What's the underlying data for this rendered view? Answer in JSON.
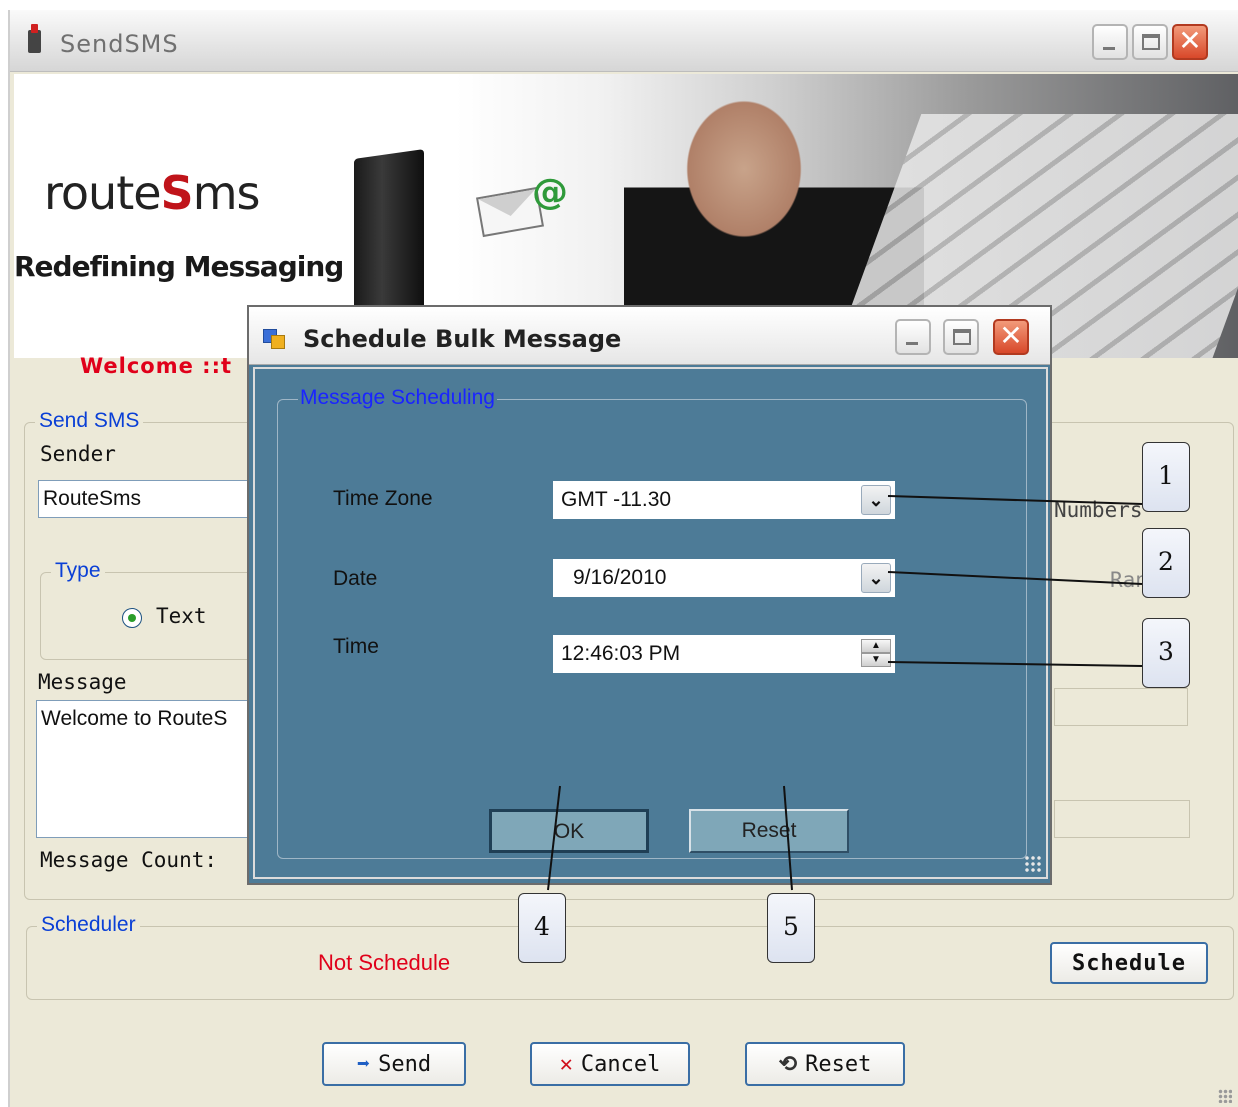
{
  "main_window": {
    "title": "SendSMS",
    "banner": {
      "logo_left": "route",
      "logo_s": "S",
      "logo_right": "ms",
      "tagline": "Redefining Messaging"
    },
    "welcome_text": "Welcome ::t",
    "send_sms": {
      "legend": "Send SMS",
      "sender_label": "Sender",
      "sender_value": "RouteSms",
      "type_legend": "Type",
      "type_option": "Text",
      "message_label": "Message",
      "message_value": "Welcome to RouteS",
      "message_count_label": "Message Count:",
      "right_partial_1": "Numbers",
      "right_partial_2": "Range"
    },
    "scheduler": {
      "legend": "Scheduler",
      "status": "Not Schedule",
      "schedule_button": "Schedule"
    },
    "buttons": {
      "send": "Send",
      "cancel": "Cancel",
      "reset": "Reset"
    }
  },
  "dialog": {
    "title": "Schedule Bulk Message",
    "group_legend": "Message Scheduling",
    "time_zone_label": "Time Zone",
    "time_zone_value": "GMT   -11.30",
    "date_label": "Date",
    "date_value": "9/16/2010",
    "time_label": "Time",
    "time_value": "12:46:03 PM",
    "ok_button": "OK",
    "reset_button": "Reset"
  },
  "callouts": [
    "1",
    "2",
    "3",
    "4",
    "5"
  ],
  "colors": {
    "accent_red": "#e0001a",
    "legend_blue": "#0a3fd6",
    "dialog_bg": "#4d7b97",
    "window_bg": "#ece9d8"
  }
}
